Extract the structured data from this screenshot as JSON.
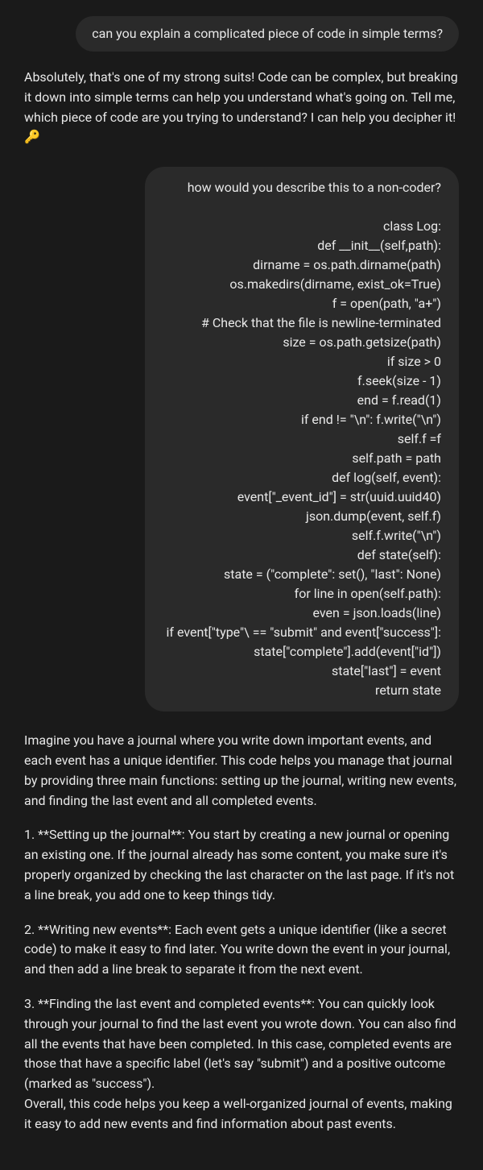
{
  "messages": {
    "user1": "can you explain a complicated piece of code in simple terms?",
    "assistant1": "Absolutely, that's one of my strong suits! Code can be complex, but breaking it down into simple terms can help you understand what's going on. Tell me, which piece of code are you trying to understand? I can help you decipher it! 🔑",
    "user2_intro": "how would you describe this to a non-coder?",
    "user2_code": [
      "class Log:",
      "def __init__(self,path):",
      "dirname = os.path.dirname(path)",
      "os.makedirs(dirname, exist_ok=True)",
      "f = open(path, \"a+\")",
      "# Check that the file is newline-terminated",
      "size = os.path.getsize(path)",
      "if size > 0",
      "f.seek(size - 1)",
      "end = f.read(1)",
      "if end != \"\\n\": f.write(\"\\n\")",
      "self.f =f",
      "self.path = path",
      "def log(self, event):",
      "event[\"_event_id\"] = str(uuid.uuid40)",
      "json.dump(event, self.f)",
      "self.f.write(\"\\n\")",
      "def state(self):",
      "state = (\"complete\": set(), \"last\": None)",
      "for line in open(self.path):",
      "even = json.loads(line)",
      "if event[\"type\"\\ == \"submit\" and event[\"success\"]:",
      "state[\"complete\"].add(event[\"id\"])",
      "state[\"last\"] = event",
      "return state"
    ],
    "assistant2_intro": "Imagine you have a journal where you write down important events, and each event has a unique identifier. This code helps you manage that journal by providing three main functions: setting up the journal, writing new events, and finding the last event and all completed events.",
    "assistant2_item1": "1. **Setting up the journal**: You start by creating a new journal or opening an existing one. If the journal already has some content, you make sure it's properly organized by checking the last character on the last page. If it's not a line break, you add one to keep things tidy.",
    "assistant2_item2": "2. **Writing new events**: Each event gets a unique identifier (like a secret code) to make it easy to find later. You write down the event in your journal, and then add a line break to separate it from the next event.",
    "assistant2_item3": "3. **Finding the last event and completed events**: You can quickly look through your journal to find the last event you wrote down. You can also find all the events that have been completed. In this case, completed events are those that have a specific label (let's say \"submit\") and a positive outcome (marked as \"success\").",
    "assistant2_summary": "Overall, this code helps you keep a well-organized journal of events, making it easy to add new events and find information about past events."
  }
}
